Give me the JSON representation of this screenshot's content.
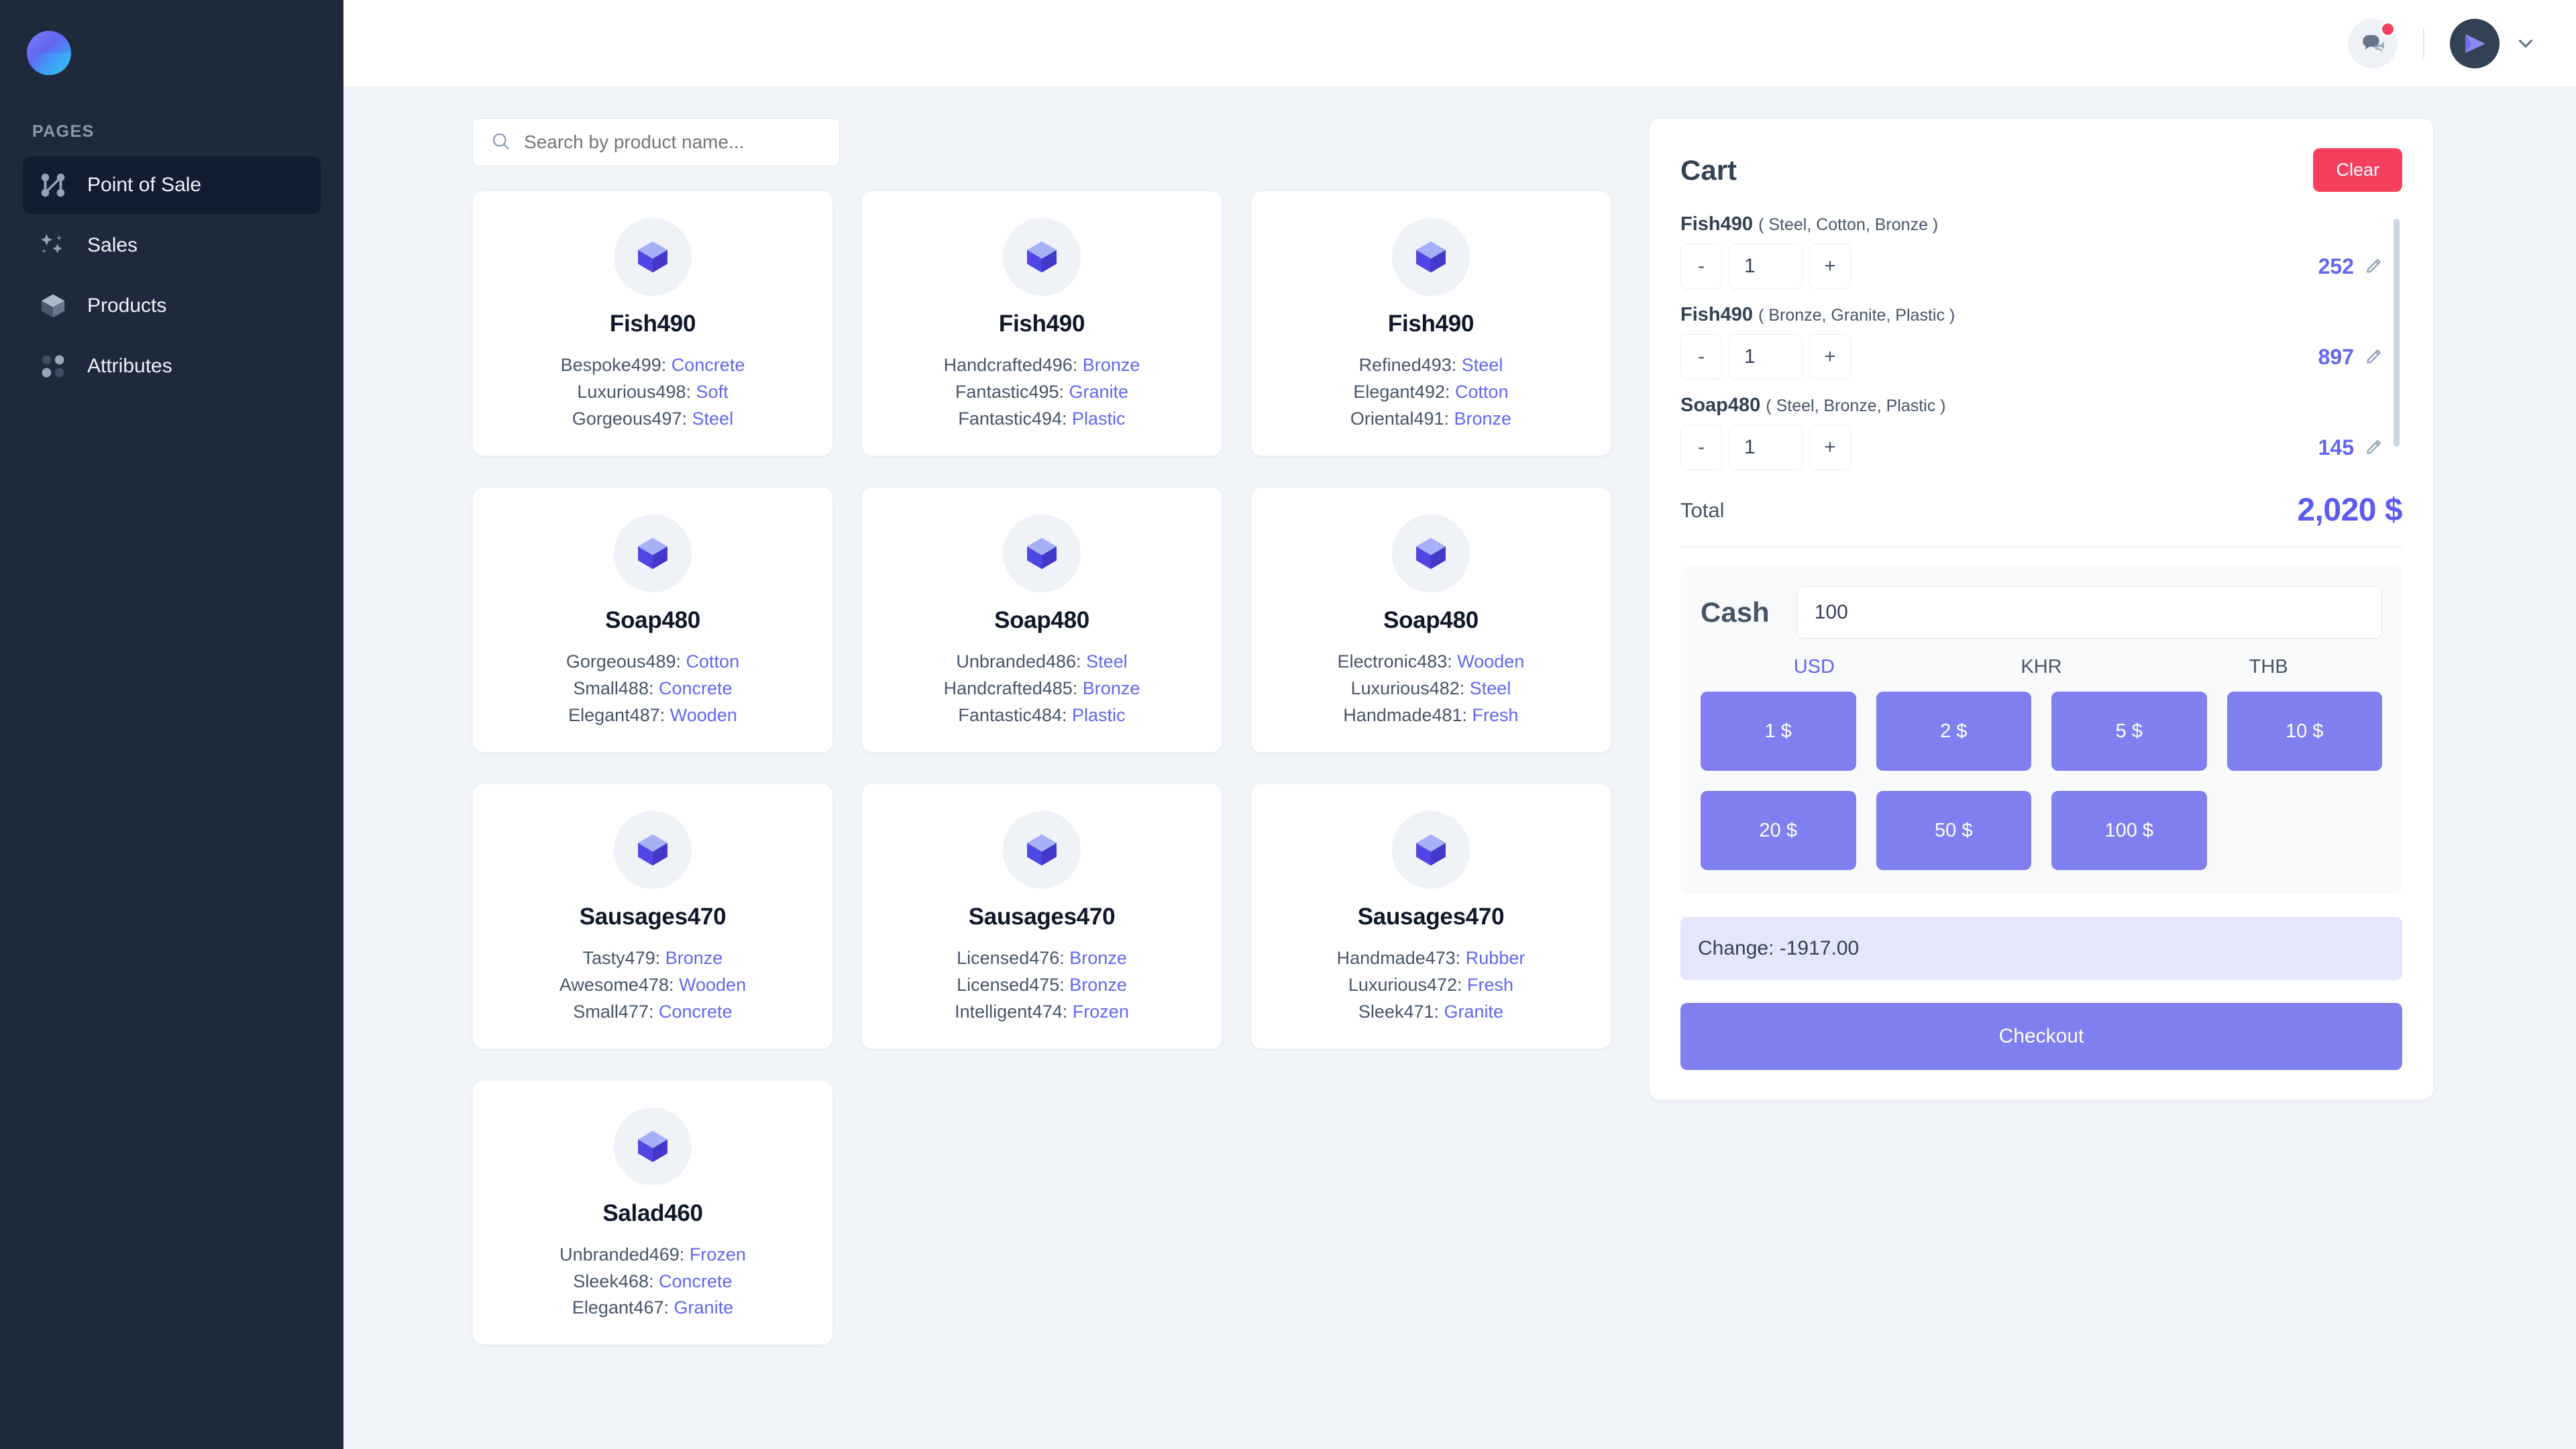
{
  "sidebar": {
    "section_label": "PAGES",
    "logo_name": "app-logo",
    "items": [
      {
        "label": "Point of Sale",
        "icon": "nodes-icon",
        "active": true
      },
      {
        "label": "Sales",
        "icon": "sparkles-icon",
        "active": false
      },
      {
        "label": "Products",
        "icon": "cube-icon",
        "active": false
      },
      {
        "label": "Attributes",
        "icon": "dots-grid-icon",
        "active": false
      }
    ]
  },
  "topbar": {
    "chat_icon": "chat-bubbles-icon",
    "notification_badge": "",
    "avatar_icon": "send-plane-icon",
    "chevron_icon": "chevron-down-icon"
  },
  "search": {
    "placeholder": "Search by product name...",
    "value": "",
    "icon": "search-icon"
  },
  "products": [
    {
      "name": "Fish490",
      "attrs": [
        {
          "key": "Bespoke499:",
          "value": "Concrete"
        },
        {
          "key": "Luxurious498:",
          "value": "Soft"
        },
        {
          "key": "Gorgeous497:",
          "value": "Steel"
        }
      ]
    },
    {
      "name": "Fish490",
      "attrs": [
        {
          "key": "Handcrafted496:",
          "value": "Bronze"
        },
        {
          "key": "Fantastic495:",
          "value": "Granite"
        },
        {
          "key": "Fantastic494:",
          "value": "Plastic"
        }
      ]
    },
    {
      "name": "Fish490",
      "attrs": [
        {
          "key": "Refined493:",
          "value": "Steel"
        },
        {
          "key": "Elegant492:",
          "value": "Cotton"
        },
        {
          "key": "Oriental491:",
          "value": "Bronze"
        }
      ]
    },
    {
      "name": "Soap480",
      "attrs": [
        {
          "key": "Gorgeous489:",
          "value": "Cotton"
        },
        {
          "key": "Small488:",
          "value": "Concrete"
        },
        {
          "key": "Elegant487:",
          "value": "Wooden"
        }
      ]
    },
    {
      "name": "Soap480",
      "attrs": [
        {
          "key": "Unbranded486:",
          "value": "Steel"
        },
        {
          "key": "Handcrafted485:",
          "value": "Bronze"
        },
        {
          "key": "Fantastic484:",
          "value": "Plastic"
        }
      ]
    },
    {
      "name": "Soap480",
      "attrs": [
        {
          "key": "Electronic483:",
          "value": "Wooden"
        },
        {
          "key": "Luxurious482:",
          "value": "Steel"
        },
        {
          "key": "Handmade481:",
          "value": "Fresh"
        }
      ]
    },
    {
      "name": "Sausages470",
      "attrs": [
        {
          "key": "Tasty479:",
          "value": "Bronze"
        },
        {
          "key": "Awesome478:",
          "value": "Wooden"
        },
        {
          "key": "Small477:",
          "value": "Concrete"
        }
      ]
    },
    {
      "name": "Sausages470",
      "attrs": [
        {
          "key": "Licensed476:",
          "value": "Bronze"
        },
        {
          "key": "Licensed475:",
          "value": "Bronze"
        },
        {
          "key": "Intelligent474:",
          "value": "Frozen"
        }
      ]
    },
    {
      "name": "Sausages470",
      "attrs": [
        {
          "key": "Handmade473:",
          "value": "Rubber"
        },
        {
          "key": "Luxurious472:",
          "value": "Fresh"
        },
        {
          "key": "Sleek471:",
          "value": "Granite"
        }
      ]
    },
    {
      "name": "Salad460",
      "attrs": [
        {
          "key": "Unbranded469:",
          "value": "Frozen"
        },
        {
          "key": "Sleek468:",
          "value": "Concrete"
        },
        {
          "key": "Elegant467:",
          "value": "Granite"
        }
      ]
    }
  ],
  "cart": {
    "title": "Cart",
    "clear_label": "Clear",
    "items": [
      {
        "name": "Fish490",
        "variant": "( Steel, Cotton, Bronze )",
        "qty": "1",
        "price": "252",
        "minus": "-",
        "plus": "+",
        "edit_icon": "pencil-icon"
      },
      {
        "name": "Fish490",
        "variant": "( Bronze, Granite, Plastic )",
        "qty": "1",
        "price": "897",
        "minus": "-",
        "plus": "+",
        "edit_icon": "pencil-icon"
      },
      {
        "name": "Soap480",
        "variant": "( Steel, Bronze, Plastic )",
        "qty": "1",
        "price": "145",
        "minus": "-",
        "plus": "+",
        "edit_icon": "pencil-icon"
      }
    ],
    "total_label": "Total",
    "total_value": "2,020 $"
  },
  "payment": {
    "cash_label": "Cash",
    "cash_value": "100",
    "cash_placeholder": "",
    "currencies": [
      {
        "code": "USD",
        "active": true
      },
      {
        "code": "KHR",
        "active": false
      },
      {
        "code": "THB",
        "active": false
      }
    ],
    "denominations": [
      "1 $",
      "2 $",
      "5 $",
      "10 $",
      "20 $",
      "50 $",
      "100 $"
    ],
    "change_text": "Change: -1917.00",
    "checkout_label": "Checkout"
  },
  "colors": {
    "sidebar_bg": "#1e293b",
    "sidebar_active": "#131d31",
    "page_bg": "#f1f5f9",
    "accent": "#6366f1",
    "button_purple": "#7f7ff0",
    "danger": "#f43f5e",
    "change_bg": "#e4e7fb"
  }
}
